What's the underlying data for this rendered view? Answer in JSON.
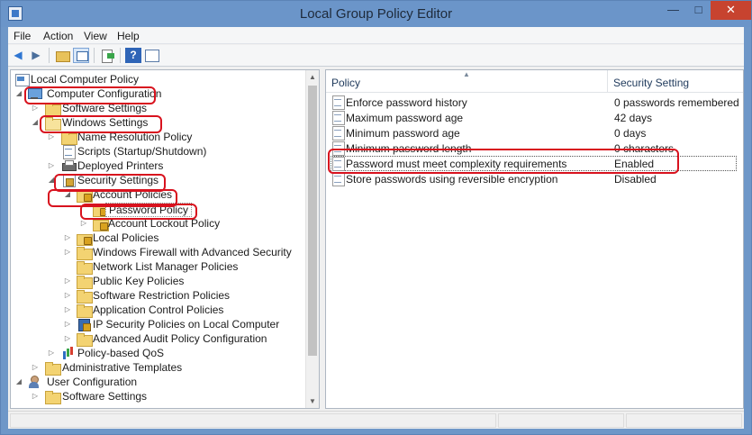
{
  "window": {
    "title": "Local Group Policy Editor"
  },
  "menu": {
    "file": "File",
    "action": "Action",
    "view": "View",
    "help": "Help"
  },
  "toolbar": {
    "icons": [
      "back-arrow-icon",
      "forward-arrow-icon",
      "up-folder-icon",
      "show-hide-tree-icon",
      "export-list-icon",
      "help-icon",
      "properties-icon"
    ]
  },
  "tree": {
    "root": "Local Computer Policy",
    "computer_configuration": "Computer Configuration",
    "software_settings": "Software Settings",
    "windows_settings": "Windows Settings",
    "name_resolution_policy": "Name Resolution Policy",
    "scripts": "Scripts (Startup/Shutdown)",
    "deployed_printers": "Deployed Printers",
    "security_settings": "Security Settings",
    "account_policies": "Account Policies",
    "password_policy": "Password Policy",
    "account_lockout_policy": "Account Lockout Policy",
    "local_policies": "Local Policies",
    "windows_firewall": "Windows Firewall with Advanced Security",
    "network_list_manager": "Network List Manager Policies",
    "public_key_policies": "Public Key Policies",
    "software_restriction": "Software Restriction Policies",
    "application_control": "Application Control Policies",
    "ip_security": "IP Security Policies on Local Computer",
    "advanced_audit": "Advanced Audit Policy Configuration",
    "policy_qos": "Policy-based QoS",
    "administrative_templates": "Administrative Templates",
    "user_configuration": "User Configuration",
    "user_software_settings": "Software Settings"
  },
  "list": {
    "columns": {
      "policy": "Policy",
      "setting": "Security Setting"
    },
    "rows": [
      {
        "policy": "Enforce password history",
        "setting": "0 passwords remembered"
      },
      {
        "policy": "Maximum password age",
        "setting": "42 days"
      },
      {
        "policy": "Minimum password age",
        "setting": "0 days"
      },
      {
        "policy": "Minimum password length",
        "setting": "0 characters"
      },
      {
        "policy": "Password must meet complexity requirements",
        "setting": "Enabled"
      },
      {
        "policy": "Store passwords using reversible encryption",
        "setting": "Disabled"
      }
    ]
  },
  "colors": {
    "titlebar": "#6b95c9",
    "close_button": "#c7432f",
    "highlight_annotation": "#d8121e"
  }
}
